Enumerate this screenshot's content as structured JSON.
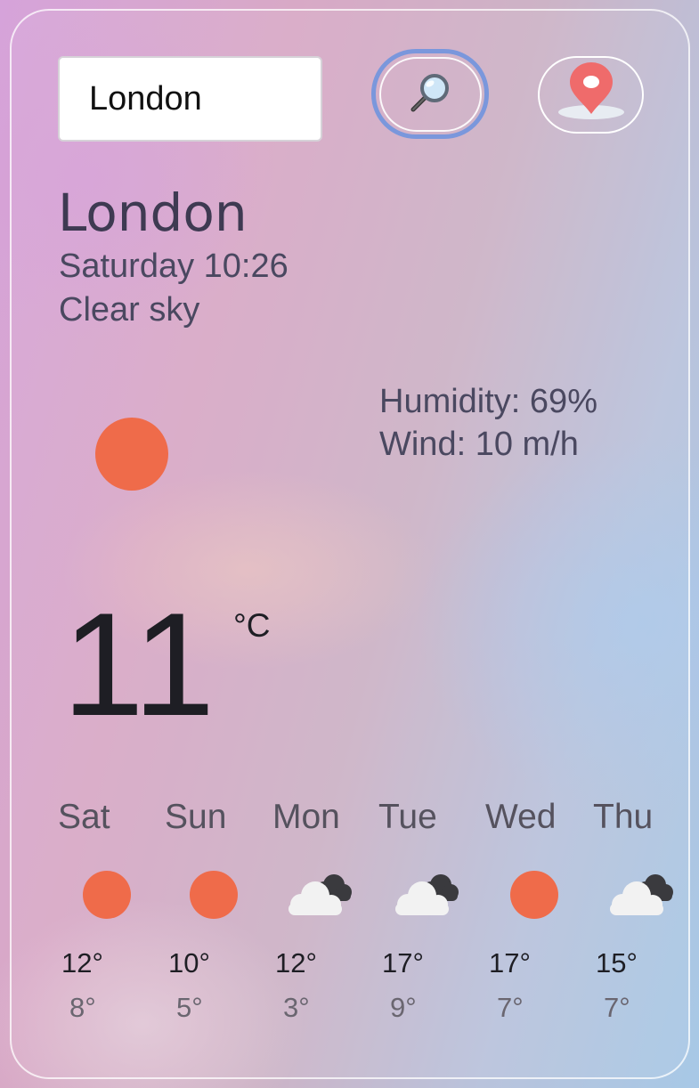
{
  "search": {
    "value": "London",
    "button_icon": "magnifier-icon",
    "location_icon": "map-pin-icon"
  },
  "current": {
    "city": "London",
    "datetime": "Saturday 10:26",
    "description": "Clear sky",
    "humidity": "Humidity: 69%",
    "wind": "Wind: 10 m/h",
    "temperature": "11",
    "unit": "°C",
    "icon": "sun-icon"
  },
  "forecast": [
    {
      "day": "Sat",
      "icon": "sun-icon",
      "high": "12°",
      "low": "8°"
    },
    {
      "day": "Sun",
      "icon": "sun-icon",
      "high": "10°",
      "low": "5°"
    },
    {
      "day": "Mon",
      "icon": "cloud-icon",
      "high": "12°",
      "low": "3°"
    },
    {
      "day": "Tue",
      "icon": "cloud-icon",
      "high": "17°",
      "low": "9°"
    },
    {
      "day": "Wed",
      "icon": "sun-icon",
      "high": "17°",
      "low": "7°"
    },
    {
      "day": "Thu",
      "icon": "cloud-icon",
      "high": "15°",
      "low": "7°"
    }
  ],
  "colors": {
    "sun": "#ef6b4a",
    "search_ring": "#7a97dc",
    "pin": "#ef6b6b"
  }
}
